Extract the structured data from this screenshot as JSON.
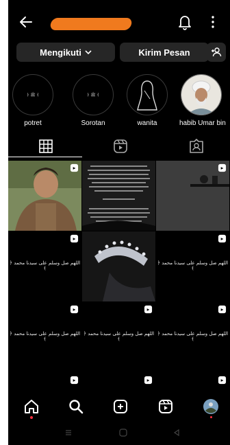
{
  "header": {
    "back_icon": "arrow-left-icon",
    "username_redacted_color": "#f07a1e",
    "notification_icon": "bell-icon",
    "menu_icon": "vertical-dots-icon"
  },
  "actions": {
    "follow_label": "Mengikuti",
    "message_label": "Kirim Pesan",
    "add_person_icon": "add-person-icon"
  },
  "highlights": [
    {
      "label": "potret"
    },
    {
      "label": "Sorotan"
    },
    {
      "label": "wanita"
    },
    {
      "label": "habib Umar bin"
    }
  ],
  "tabs": [
    {
      "name": "grid",
      "icon": "grid-icon",
      "active": true
    },
    {
      "name": "reels",
      "icon": "reels-icon",
      "active": false
    },
    {
      "name": "tagged",
      "icon": "tagged-icon",
      "active": false
    }
  ],
  "grid_posts": [
    {
      "type": "photo-boy",
      "reel": true
    },
    {
      "type": "text-dark",
      "reel": false
    },
    {
      "type": "photo-shelf",
      "reel": true
    },
    {
      "type": "calligraphy",
      "reel": true
    },
    {
      "type": "photo-crown",
      "reel": false
    },
    {
      "type": "calligraphy",
      "reel": true
    },
    {
      "type": "calligraphy",
      "reel": true
    },
    {
      "type": "calligraphy",
      "reel": true
    },
    {
      "type": "calligraphy",
      "reel": true
    },
    {
      "type": "calligraphy",
      "reel": true
    },
    {
      "type": "calligraphy",
      "reel": true
    },
    {
      "type": "calligraphy",
      "reel": true
    }
  ],
  "bottom_nav": [
    {
      "icon": "home-icon",
      "active": true
    },
    {
      "icon": "search-icon",
      "active": false
    },
    {
      "icon": "create-icon",
      "active": false
    },
    {
      "icon": "reels-icon",
      "active": false
    },
    {
      "icon": "profile-avatar",
      "active": false
    }
  ],
  "system_nav": [
    "recents-icon",
    "home-button-icon",
    "back-triangle-icon"
  ]
}
